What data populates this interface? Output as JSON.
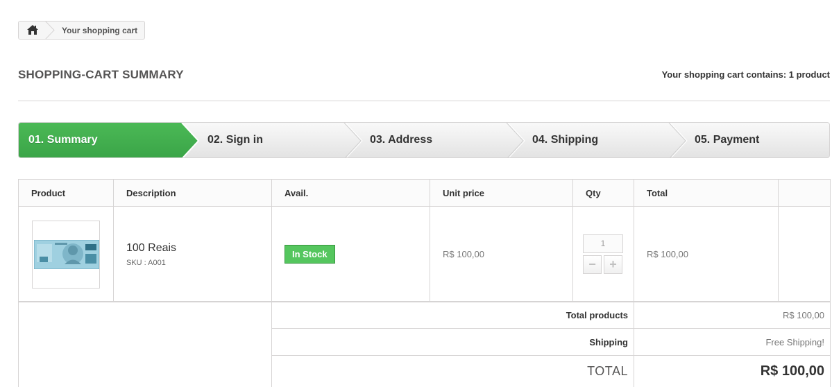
{
  "breadcrumb": {
    "home_icon": "home-icon",
    "current": "Your shopping cart"
  },
  "heading": {
    "title": "Shopping-cart summary",
    "cart_count": "Your shopping cart contains: 1 product"
  },
  "steps": [
    {
      "label": "01. Summary",
      "active": true
    },
    {
      "label": "02. Sign in",
      "active": false
    },
    {
      "label": "03. Address",
      "active": false
    },
    {
      "label": "04. Shipping",
      "active": false
    },
    {
      "label": "05. Payment",
      "active": false
    }
  ],
  "table": {
    "headers": [
      "Product",
      "Description",
      "Avail.",
      "Unit price",
      "Qty",
      "Total"
    ],
    "row": {
      "image_icon": "banknote-100-reais-image",
      "name": "100 Reais",
      "sku": "SKU : A001",
      "availability": "In Stock",
      "unit_price": "R$ 100,00",
      "qty": "1",
      "minus_label": "−",
      "plus_label": "+",
      "total": "R$ 100,00"
    }
  },
  "summary": {
    "total_products_label": "Total products",
    "total_products_value": "R$ 100,00",
    "shipping_label": "Shipping",
    "shipping_value": "Free Shipping!",
    "total_label": "TOTAL",
    "total_value": "R$ 100,00"
  },
  "colors": {
    "active_step": "#46a74e",
    "stock_badge": "#55c65e",
    "border": "#d6d4d4"
  }
}
